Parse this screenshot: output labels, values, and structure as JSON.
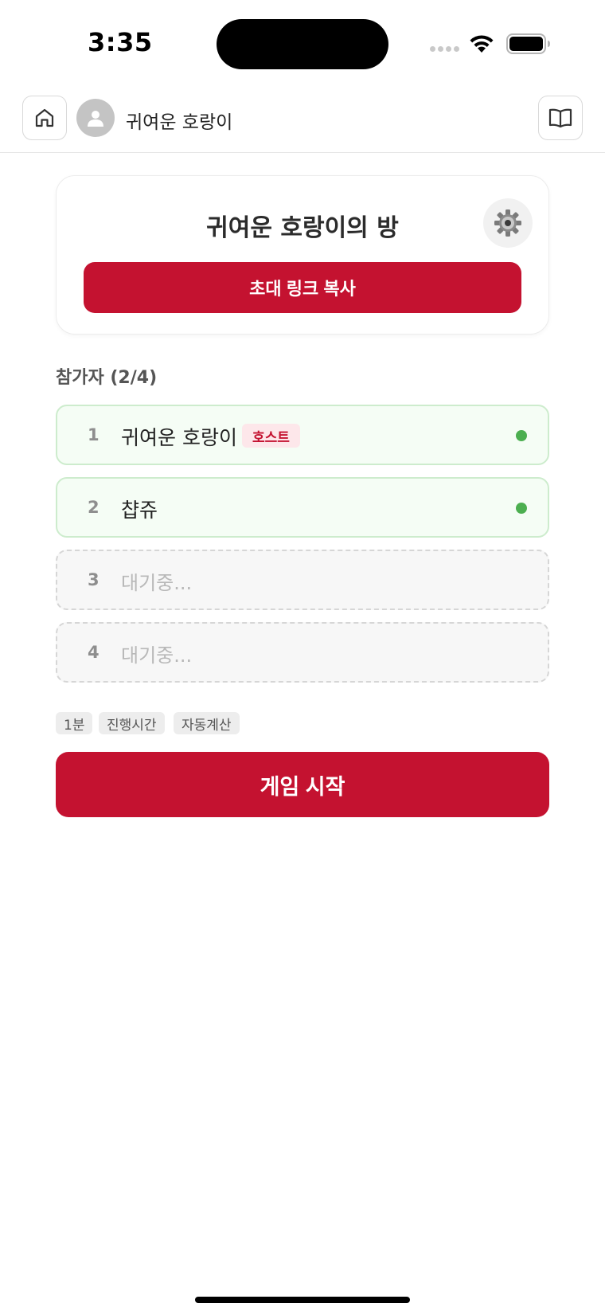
{
  "status_bar": {
    "time": "3:35",
    "icons": [
      "signal-icon",
      "wifi-icon",
      "battery-icon"
    ]
  },
  "header": {
    "home_icon": "home-icon",
    "avatar_icon": "person-icon",
    "user_name": "귀여운 호랑이",
    "guide_icon": "book-icon"
  },
  "room": {
    "title": "귀여운 호랑이의 방",
    "settings_icon": "gear-icon",
    "invite_button": "초대 링크 복사"
  },
  "participants": {
    "heading": "참가자 (2/4)",
    "slots": [
      {
        "number": "1",
        "name": "귀여운 호랑이",
        "badge": "호스트",
        "online": true
      },
      {
        "number": "2",
        "name": "챱쥬",
        "online": true
      },
      {
        "number": "3",
        "waiting": "대기중..."
      },
      {
        "number": "4",
        "waiting": "대기중..."
      }
    ]
  },
  "tags": [
    "1분",
    "진행시간",
    "자동계산"
  ],
  "start_button": "게임 시작",
  "colors": {
    "primary": "#c41230",
    "online": "#4caf50",
    "slot_filled_bg": "#f5fdf5",
    "slot_filled_border": "#cdeccd",
    "host_badge_bg": "#fde7ea"
  }
}
